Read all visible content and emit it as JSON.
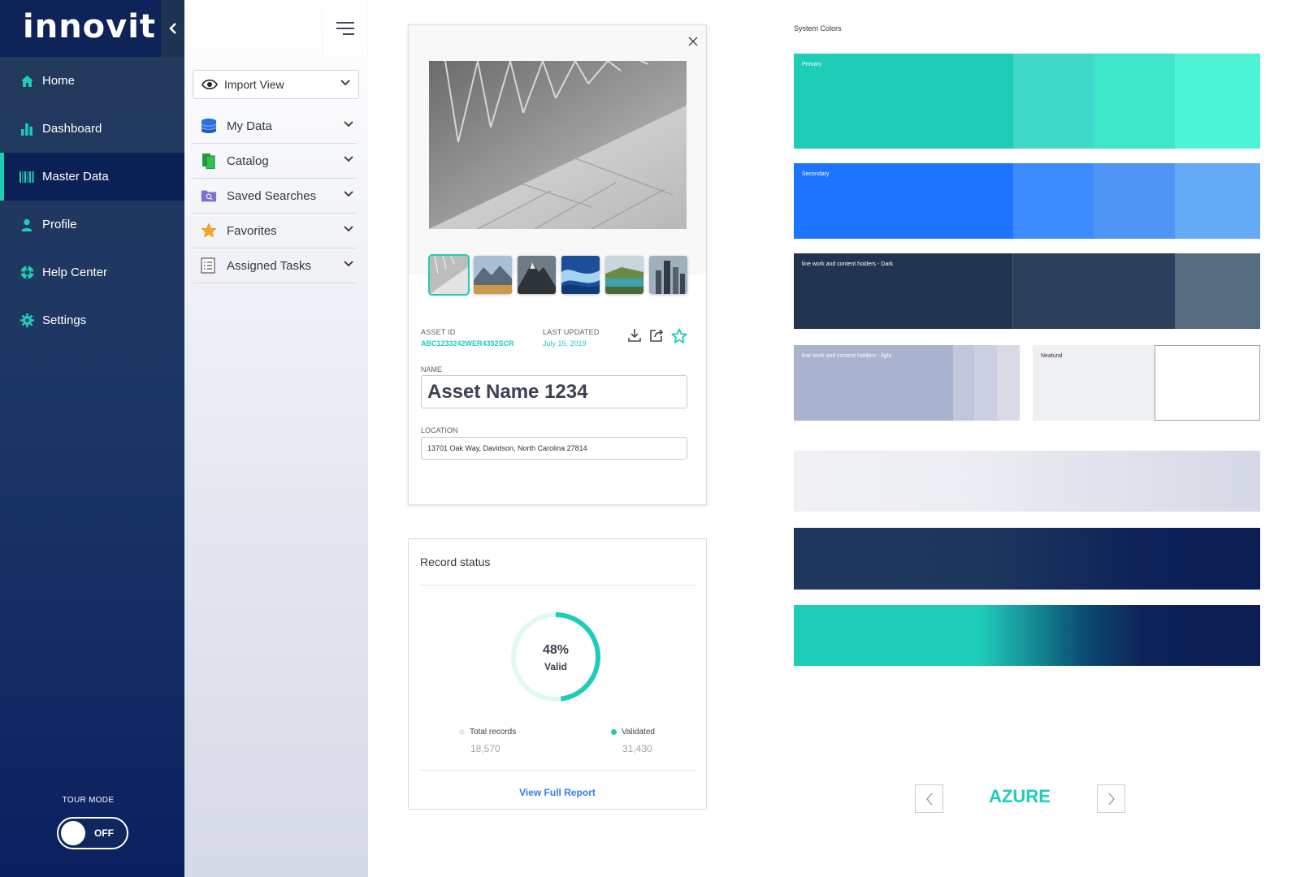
{
  "brand": {
    "logo_text": "innovit"
  },
  "nav": {
    "items": [
      {
        "label": "Home",
        "icon": "home-icon",
        "active": false
      },
      {
        "label": "Dashboard",
        "icon": "bar-chart-icon",
        "active": false
      },
      {
        "label": "Master Data",
        "icon": "barcode-icon",
        "active": true
      },
      {
        "label": "Profile",
        "icon": "user-icon",
        "active": false
      },
      {
        "label": "Help Center",
        "icon": "lifebuoy-icon",
        "active": false
      },
      {
        "label": "Settings",
        "icon": "gear-icon",
        "active": false
      }
    ],
    "tour_mode_label": "TOUR MODE",
    "tour_mode_state": "OFF"
  },
  "panel": {
    "view_select": "Import View",
    "menu": [
      {
        "label": "My Data",
        "icon": "database-icon"
      },
      {
        "label": "Catalog",
        "icon": "catalog-icon"
      },
      {
        "label": "Saved Searches",
        "icon": "folder-search-icon"
      },
      {
        "label": "Favorites",
        "icon": "star-icon"
      },
      {
        "label": "Assigned Tasks",
        "icon": "checklist-icon"
      }
    ]
  },
  "asset": {
    "id_label": "ASSET ID",
    "id_value": "ABC1233242WER4352SCR",
    "updated_label": "LAST UPDATED",
    "updated_value": "July 15, 2019",
    "name_label": "NAME",
    "name_value": "Asset Name 1234",
    "location_label": "LOCATION",
    "location_value": "13701 Oak Way, Davidson, North Carolina 27814"
  },
  "record_status": {
    "title": "Record status",
    "percent": "48%",
    "percent_value": 0.48,
    "percent_label": "Valid",
    "legend": [
      {
        "label": "Total records",
        "value": "18,570",
        "color": "#e6e8f2"
      },
      {
        "label": "Validated",
        "value": "31,430",
        "color": "#1ecdb8"
      }
    ],
    "link": "View Full Report"
  },
  "colors": {
    "title": "System Colors",
    "primary_label": "Primary",
    "secondary_label": "Secondary",
    "dark_label": "line work and content holders - Dark",
    "light_label": "line work and content holders - light",
    "neutral_label": "Neatural",
    "primary": [
      "#1ecdb8",
      "#40d8c6",
      "#3de6c8",
      "#4cf3d4"
    ],
    "secondary": [
      "#1f74ff",
      "#3c8cff",
      "#4f95f6",
      "#65aaf6"
    ],
    "dark": [
      "#22344f",
      "#2c3f5a",
      "#566a80"
    ],
    "light": [
      "#a9b2ce",
      "#c1c6dc",
      "#cbcfe1",
      "#d8dbe6"
    ],
    "neutral": [
      "#eff0f4",
      "#ffffff"
    ]
  },
  "theme": {
    "name": "AZURE"
  }
}
